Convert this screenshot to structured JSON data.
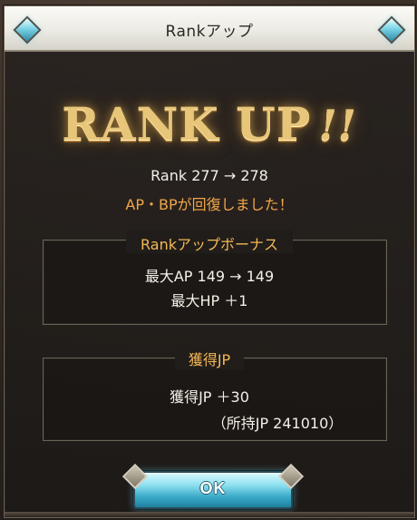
{
  "dialog": {
    "title": "Rankアップ",
    "banner_main": "RANK UP",
    "banner_bang": "!!",
    "rank_line": "Rank 277 → 278",
    "recovery_line": "AP・BPが回復しました！"
  },
  "bonus_panel": {
    "header": "Rankアップボーナス",
    "lines": [
      "最大AP 149 → 149",
      "最大HP ＋1"
    ]
  },
  "jp_panel": {
    "header": "獲得JP",
    "gain_line": "獲得JP ＋30",
    "held_line": "（所持JP 241010）"
  },
  "actions": {
    "ok_label": "OK"
  },
  "colors": {
    "accent_orange": "#f2a64a",
    "title_gold": "#e7c579",
    "ok_cyan": "#3aa9c8"
  }
}
